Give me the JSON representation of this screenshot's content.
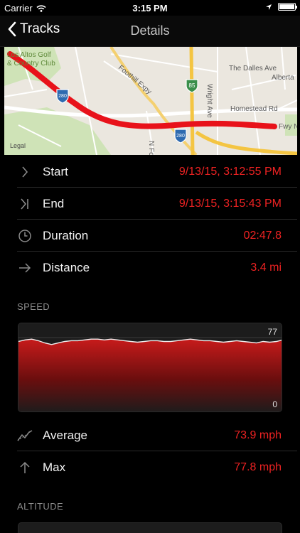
{
  "status_bar": {
    "carrier": "Carrier",
    "time": "3:15 PM"
  },
  "nav": {
    "back_label": "Tracks",
    "title": "Details"
  },
  "map": {
    "labels": [
      "Los Altos Golf",
      "& Country Club",
      "Foothill Expy",
      "The Dalles Ave",
      "Alberta",
      "Wright Ave",
      "Homestead Rd",
      "Fwy N",
      "N Fo",
      "Legal"
    ],
    "shields": [
      "280",
      "85",
      "280"
    ]
  },
  "rows": {
    "start": {
      "label": "Start",
      "value": "9/13/15, 3:12:55 PM"
    },
    "end": {
      "label": "End",
      "value": "9/13/15, 3:15:43 PM"
    },
    "duration": {
      "label": "Duration",
      "value": "02:47.8"
    },
    "distance": {
      "label": "Distance",
      "value": "3.4 mi"
    },
    "average": {
      "label": "Average",
      "value": "73.9 mph"
    },
    "max": {
      "label": "Max",
      "value": "77.8 mph"
    }
  },
  "speed": {
    "section_title": "SPEED",
    "max_label": "77",
    "min_label": "0"
  },
  "altitude": {
    "section_title": "ALTITUDE"
  },
  "chart_data": {
    "type": "area",
    "ylim": [
      0,
      77
    ],
    "values": [
      72,
      74,
      75,
      73,
      70,
      68,
      70,
      72,
      73,
      73,
      74,
      75,
      75,
      74,
      75,
      74,
      73,
      72,
      71,
      72,
      73,
      73,
      72,
      72,
      73,
      74,
      75,
      74,
      73,
      73,
      72,
      71,
      72,
      73,
      72,
      71,
      70,
      72,
      71,
      72,
      74
    ]
  },
  "colors": {
    "accent": "#ee2222",
    "route": "#e8121a"
  }
}
